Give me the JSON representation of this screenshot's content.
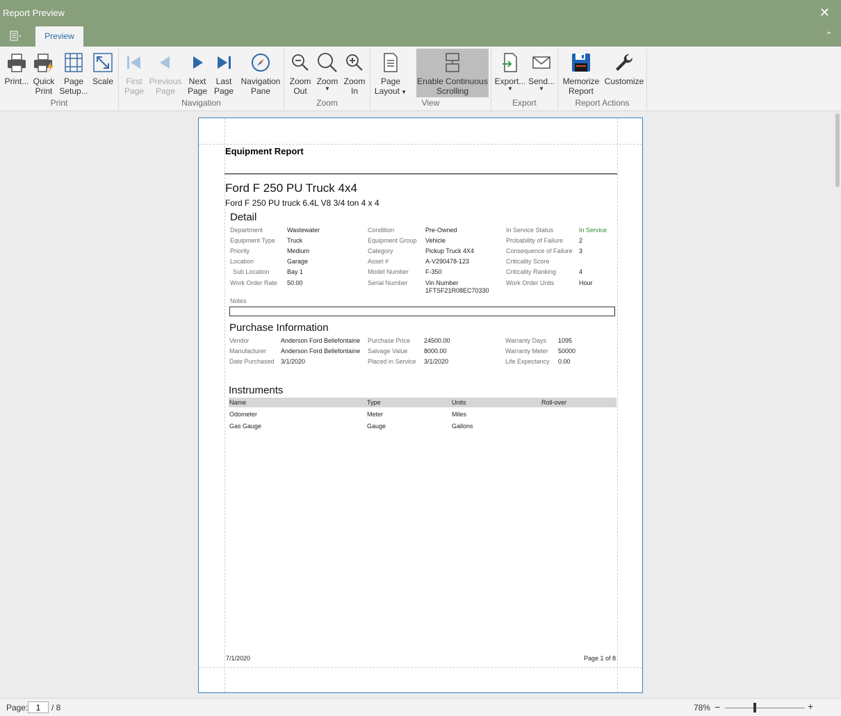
{
  "window": {
    "title": "Report Preview"
  },
  "tabs": {
    "preview": "Preview"
  },
  "ribbon": {
    "print": "Print...",
    "quick_print": "Quick Print",
    "page_setup": "Page Setup...",
    "scale": "Scale",
    "first_page": "First Page",
    "previous_page": "Previous Page",
    "next_page": "Next Page",
    "last_page": "Last Page",
    "navigation_pane": "Navigation Pane",
    "zoom_out": "Zoom Out",
    "zoom": "Zoom",
    "zoom_in": "Zoom In",
    "page_layout": "Page Layout",
    "enable_continuous_scrolling": "Enable Continuous Scrolling",
    "export": "Export...",
    "send": "Send...",
    "memorize_report": "Memorize Report",
    "customize": "Customize",
    "groups": {
      "print": "Print",
      "navigation": "Navigation",
      "zoom": "Zoom",
      "view": "View",
      "export": "Export",
      "report_actions": "Report Actions"
    }
  },
  "report": {
    "title": "Equipment Report",
    "equipment_name": "Ford F 250 PU Truck 4x4",
    "equipment_description": "Ford F 250 PU truck 6.4L  V8 3/4 ton 4 x 4",
    "detail": {
      "title": "Detail",
      "department_label": "Department",
      "department": "Wastewater",
      "equipment_type_label": "Equipment Type",
      "equipment_type": "Truck",
      "priority_label": "Priority",
      "priority": "Medium",
      "location_label": "Location",
      "location": "Garage",
      "sub_location_label": "Sub Location",
      "sub_location": "Bay 1",
      "work_order_rate_label": "Work Order Rate",
      "work_order_rate": "50.00",
      "condition_label": "Condition",
      "condition": "Pre-Owned",
      "equipment_group_label": "Equipment Group",
      "equipment_group": "Vehicle",
      "category_label": "Category",
      "category": "Pickup Truck 4X4",
      "asset_label": "Asset #",
      "asset": "A-V290478-123",
      "model_number_label": "Model Number",
      "model_number": "F-350",
      "serial_number_label": "Serial Number",
      "serial_number_line1": "Vin Number",
      "serial_number_line2": "1FTSF21R08EC70330",
      "in_service_status_label": "In Service Status",
      "in_service_status": "In Service",
      "probability_of_failure_label": "Probability of Failure",
      "probability_of_failure": "2",
      "consequence_of_failure_label": "Consequence of Failure",
      "consequence_of_failure": "3",
      "criticality_score_label": "Criticality Score",
      "criticality_score": "",
      "criticality_ranking_label": "Criticality Ranking",
      "criticality_ranking": "4",
      "work_order_units_label": "Work Order Units",
      "work_order_units": "Hour",
      "notes_label": "Notes"
    },
    "purchase": {
      "title": "Purchase Information",
      "vendor_label": "Vendor",
      "vendor": "Anderson Ford Bellefontaine",
      "manufacturer_label": "Manufacturer",
      "manufacturer": "Anderson Ford Bellefontaine",
      "date_purchased_label": "Date Purchased",
      "date_purchased": "3/1/2020",
      "purchase_price_label": "Purchase Price",
      "purchase_price": "24500.00",
      "salvage_value_label": "Salvage Value",
      "salvage_value": "8000.00",
      "placed_in_service_label": "Placed in Service",
      "placed_in_service": "3/1/2020",
      "warranty_days_label": "Warranty Days",
      "warranty_days": "1095",
      "warranty_meter_label": "Warranty Meter",
      "warranty_meter": "50000",
      "life_expectancy_label": "Life Expectancy",
      "life_expectancy": "0.00"
    },
    "instruments": {
      "title": "Instruments",
      "columns": [
        "Name",
        "Type",
        "Units",
        "Roll-over"
      ],
      "rows": [
        [
          "Odometer",
          "Meter",
          "Miles",
          ""
        ],
        [
          "Gas Gauge",
          "Gauge",
          "Gallons",
          ""
        ]
      ]
    },
    "footer": {
      "date": "7/1/2020",
      "page": "Page 1 of 8"
    }
  },
  "statusbar": {
    "page_label": "Page:",
    "page_value": "1",
    "page_total": "/ 8",
    "zoom": "78%",
    "zoom_minus": "−",
    "zoom_plus": "+"
  }
}
